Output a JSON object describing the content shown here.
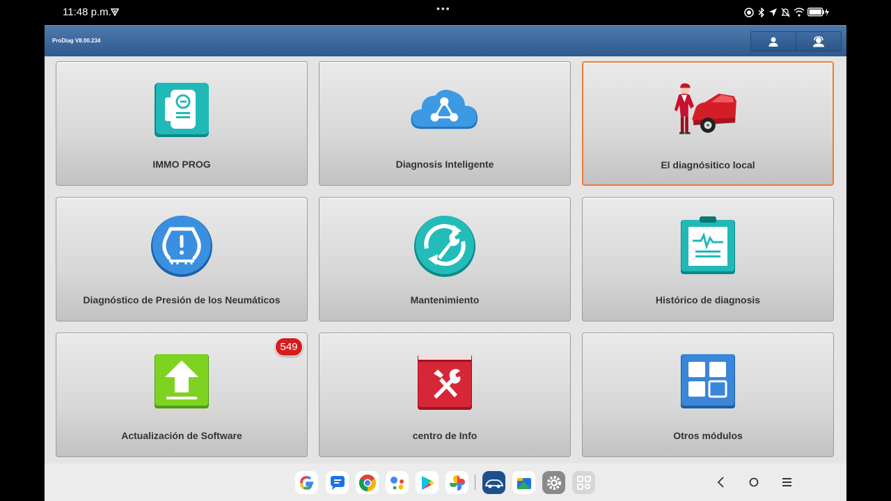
{
  "status": {
    "time": "11:48 p.m.",
    "dots": "•••"
  },
  "header": {
    "version": "ProDiag V8.00.234"
  },
  "tiles": [
    {
      "label": "IMMO PROG"
    },
    {
      "label": "Diagnosis Inteligente"
    },
    {
      "label": "El diagnósitico local"
    },
    {
      "label": "Diagnóstico de Presión de los Neumáticos"
    },
    {
      "label": "Mantenimiento"
    },
    {
      "label": "Histórico de diagnosis"
    },
    {
      "label": "Actualización de Software",
      "badge": "549"
    },
    {
      "label": "centro de Info"
    },
    {
      "label": "Otros módulos"
    }
  ],
  "colors": {
    "header": "#2f5a8e",
    "selected_border": "#ee7b32",
    "badge": "#d51d1d"
  }
}
